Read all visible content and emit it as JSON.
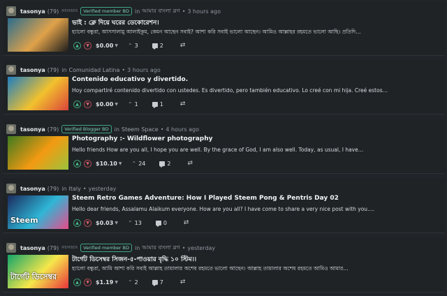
{
  "posts": [
    {
      "author": "tasonya",
      "reputation": "(79)",
      "member_label": "MEMBER",
      "badge": "Verified member BD",
      "in_label": "in",
      "community": "আমার বাংলা ব্লগ",
      "time": "3 hours ago",
      "title": "ভাই : ক্লে দিয়ে ঘরের ডেকোরেশন।",
      "summary": "হ্যালো বন্ধুরা, আসসালামু আলাইকুম, কেমন আছেন সবাই? আশা করি সবাই ভালো আছেন। আমিও আল্লাহর রহমতে ভালো আছি। প্রতিদি…",
      "payout": "$0.00",
      "votes": "3",
      "comments": "2",
      "thumb_colors": [
        "#2a6d8e",
        "#e0a24a",
        "#1d1d1d"
      ]
    },
    {
      "author": "tasonya",
      "reputation": "(79)",
      "member_label": "",
      "badge": "",
      "in_label": "in",
      "community": "Comunidad Latina",
      "time": "3 hours ago",
      "title": "Contenido educativo y divertido.",
      "summary": "Hoy compartiré contenido divertido con ustedes. Es divertido, pero también educativo. Lo creé con mi hija. Creé estos…",
      "payout": "$0.00",
      "votes": "1",
      "comments": "1",
      "thumb_colors": [
        "#1e7ec0",
        "#f2c12e",
        "#d9443a"
      ]
    },
    {
      "author": "tasonya",
      "reputation": "(79)",
      "member_label": "",
      "badge": "Verified Blogger BD",
      "in_label": "in",
      "community": "Steem Space",
      "time": "4 hours ago",
      "title": "Photography :- Wildflower photography",
      "summary": "Hello friends How are you all, I hope you are well. By the grace of God, I am also well. Today, as usual, I have…",
      "payout": "$10.10",
      "votes": "24",
      "comments": "2",
      "thumb_colors": [
        "#3f7a20",
        "#f39a12",
        "#9bc23c"
      ]
    },
    {
      "author": "tasonya",
      "reputation": "(79)",
      "member_label": "",
      "badge": "",
      "in_label": "in",
      "community": "Italy",
      "time": "yesterday",
      "title": "Steem Retro Games Adventure: How I Played Steem Pong & Pentris Day 02",
      "summary": "Hello dear friends, Assalamu Alaikum everyone. How are you all? I have come to share a very nice post with you….",
      "payout": "$0.03",
      "votes": "13",
      "comments": "0",
      "thumb_colors": [
        "#1a2a5e",
        "#2fb6d6",
        "#e94b8a"
      ],
      "thumb_text": "Steem"
    },
    {
      "author": "tasonya",
      "reputation": "(79)",
      "member_label": "MEMBER",
      "badge": "Verified member BD",
      "in_label": "in",
      "community": "আমার বাংলা ব্লগ",
      "time": "yesterday",
      "title": "টার্গেট ডিসেম্বর সিজন-৫-পাওয়ার বৃদ্ধি ১০ স্টিম।।",
      "summary": "হ্যালো বন্ধুরা, আমি আশা করি সবাই আল্লাহ তায়ালার অশেষ রহমতে ভালো আছেন। আল্লাহ তায়ালার অশেষ রহমতে আমিও আমার…",
      "payout": "$1.19",
      "votes": "2",
      "comments": "7",
      "thumb_colors": [
        "#12a56a",
        "#f6e64b",
        "#e8333b"
      ],
      "thumb_text": "টার্গেট ডিসেম্বর"
    }
  ]
}
